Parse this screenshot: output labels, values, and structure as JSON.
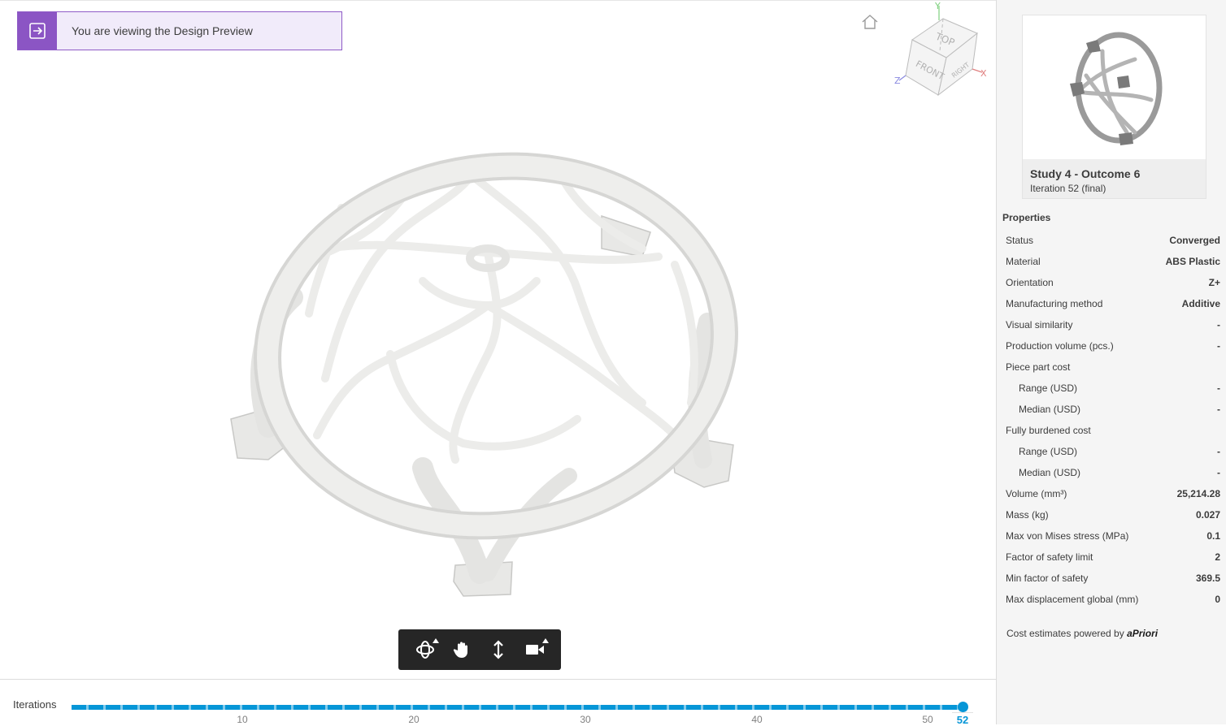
{
  "banner": {
    "text": "You are viewing the Design Preview"
  },
  "viewcube": {
    "top": "TOP",
    "front": "FRONT",
    "right": "RIGHT",
    "axis_x": "X",
    "axis_y": "Y",
    "axis_z": "Z"
  },
  "toolbar": {
    "tools": [
      "orbit-icon",
      "pan-icon",
      "zoom-icon",
      "camera-icon"
    ]
  },
  "timeline": {
    "label": "Iterations",
    "ticks": [
      "10",
      "20",
      "30",
      "40",
      "50"
    ],
    "current": "52",
    "progress": 1.0
  },
  "outcome": {
    "title": "Study 4 - Outcome 6",
    "subtitle": "Iteration 52 (final)"
  },
  "properties": {
    "title": "Properties",
    "rows": [
      {
        "k": "Status",
        "v": "Converged"
      },
      {
        "k": "Material",
        "v": "ABS Plastic"
      },
      {
        "k": "Orientation",
        "v": "Z+"
      },
      {
        "k": "Manufacturing method",
        "v": "Additive"
      },
      {
        "k": "Visual similarity",
        "v": "-"
      },
      {
        "k": "Production volume (pcs.)",
        "v": "-"
      },
      {
        "k": "Piece part cost",
        "v": ""
      },
      {
        "k": "Range (USD)",
        "v": "-"
      },
      {
        "k": "Median (USD)",
        "v": "-"
      },
      {
        "k": "Fully burdened cost",
        "v": ""
      },
      {
        "k": "Range (USD)",
        "v": "-"
      },
      {
        "k": "Median (USD)",
        "v": "-"
      },
      {
        "k": "Volume (mm³)",
        "v": "25,214.28"
      },
      {
        "k": "Mass (kg)",
        "v": "0.027"
      },
      {
        "k": "Max von Mises stress (MPa)",
        "v": "0.1"
      },
      {
        "k": "Factor of safety limit",
        "v": "2"
      },
      {
        "k": "Min factor of safety",
        "v": "369.5"
      },
      {
        "k": "Max displacement global (mm)",
        "v": "0"
      }
    ]
  },
  "footer": {
    "cost_text": "Cost estimates powered by",
    "brand": "aPriori"
  }
}
